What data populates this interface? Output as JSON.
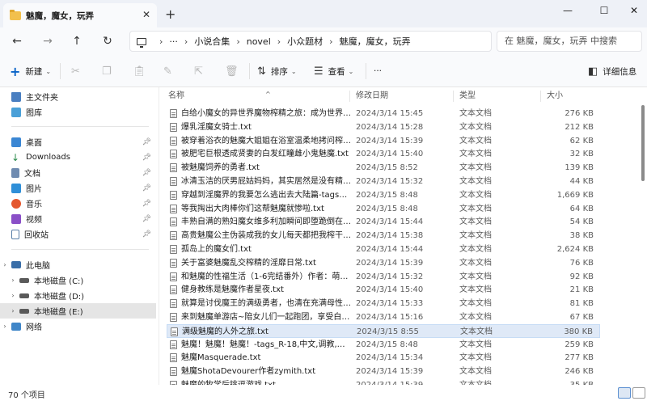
{
  "window": {
    "tab_title": "魅魔，魔女，玩弄",
    "tab_close": "✕",
    "new_tab": "+",
    "minimize": "—",
    "maximize": "☐",
    "close": "✕"
  },
  "nav": {
    "back": "←",
    "forward": "→",
    "up": "↑",
    "refresh": "↻",
    "expand": "›",
    "more": "···",
    "breadcrumb": [
      "小说合集",
      "novel",
      "小众题材",
      "魅魔，魔女，玩弄"
    ],
    "search_placeholder": "在 魅魔，魔女，玩弄 中搜索"
  },
  "toolbar": {
    "new_label": "新建",
    "sort_label": "排序",
    "view_label": "查看",
    "more": "···",
    "details_label": "详细信息",
    "caret": "⌄"
  },
  "sidebar": {
    "home": "主文件夹",
    "gallery": "图库",
    "desktop": "桌面",
    "downloads": "Downloads",
    "documents": "文档",
    "pictures": "图片",
    "music": "音乐",
    "videos": "视频",
    "recycle": "回收站",
    "this_pc": "此电脑",
    "drive_c": "本地磁盘 (C:)",
    "drive_d": "本地磁盘 (D:)",
    "drive_e": "本地磁盘 (E:)",
    "network": "网络",
    "expand_arrow": "›"
  },
  "columns": {
    "name": "名称",
    "date": "修改日期",
    "type": "类型",
    "size": "大小"
  },
  "files": [
    {
      "name": "白给小魔女的异世界魔物榨精之旅：成为世界最...",
      "date": "2024/3/14 15:45",
      "type": "文本文档",
      "size": "276 KB"
    },
    {
      "name": "爆乳淫魔女骑士.txt",
      "date": "2024/3/14 15:28",
      "type": "文本文档",
      "size": "212 KB"
    },
    {
      "name": "被穿着浴衣的魅魔大姐姐在浴室温柔地拷问榨干...",
      "date": "2024/3/14 15:39",
      "type": "文本文档",
      "size": "62 KB"
    },
    {
      "name": "被肥宅巨根透成贤妻的白发红瞳雌小鬼魅魔.txt",
      "date": "2024/3/14 15:40",
      "type": "文本文档",
      "size": "32 KB"
    },
    {
      "name": "被魅魔饲养的勇者.txt",
      "date": "2024/3/15 8:52",
      "type": "文本文档",
      "size": "139 KB"
    },
    {
      "name": "冰清玉洁的厌男屁姑妈妈，其实居然是没有精液...",
      "date": "2024/3/14 15:32",
      "type": "文本文档",
      "size": "44 KB"
    },
    {
      "name": "穿越到淫魔界的我要怎么逃出去大陆篇-tags_R...",
      "date": "2024/3/15 8:48",
      "type": "文本文档",
      "size": "1,669 KB"
    },
    {
      "name": "等我掏出大肉棒你们这帮魅魔就惨啦.txt",
      "date": "2024/3/15 8:48",
      "type": "文本文档",
      "size": "64 KB"
    },
    {
      "name": "丰熟自满的熟妇魔女维多利加瞬间即堕跪倒在雄...",
      "date": "2024/3/14 15:44",
      "type": "文本文档",
      "size": "54 KB"
    },
    {
      "name": "高贵魅魔公主伪装成我的女儿每天都把我榨干这...",
      "date": "2024/3/14 15:38",
      "type": "文本文档",
      "size": "38 KB"
    },
    {
      "name": "孤岛上的魔女们.txt",
      "date": "2024/3/14 15:44",
      "type": "文本文档",
      "size": "2,624 KB"
    },
    {
      "name": "关于富婆魅魔乱交榨精的淫靡日常.txt",
      "date": "2024/3/14 15:39",
      "type": "文本文档",
      "size": "76 KB"
    },
    {
      "name": "和魅魔的性福生活（1-6完结番外）作者：萌猫...",
      "date": "2024/3/14 15:32",
      "type": "文本文档",
      "size": "92 KB"
    },
    {
      "name": "健身教练是魅魔作者星夜.txt",
      "date": "2024/3/14 15:40",
      "type": "文本文档",
      "size": "21 KB"
    },
    {
      "name": "就算是讨伐魔王的满级勇者，也清在充满母性的...",
      "date": "2024/3/14 15:33",
      "type": "文本文档",
      "size": "81 KB"
    },
    {
      "name": "来到魅魔单游店~陪女儿们一起跑团，享受白丝...",
      "date": "2024/3/14 15:16",
      "type": "文本文档",
      "size": "67 KB"
    },
    {
      "name": "满级魅魔的人外之旅.txt",
      "date": "2024/3/15 8:55",
      "type": "文本文档",
      "size": "380 KB"
    },
    {
      "name": "魅魔！魅魔！魅魔！-tags_R-18,中文,调教,ドM...",
      "date": "2024/3/15 8:48",
      "type": "文本文档",
      "size": "259 KB"
    },
    {
      "name": "魅魔Masquerade.txt",
      "date": "2024/3/14 15:34",
      "type": "文本文档",
      "size": "277 KB"
    },
    {
      "name": "魅魔ShotaDevourer作者zymith.txt",
      "date": "2024/3/14 15:39",
      "type": "文本文档",
      "size": "246 KB"
    },
    {
      "name": "魅魔的牧学后挑逗游戏.txt",
      "date": "2024/3/14 15:39",
      "type": "文本文档",
      "size": "35 KB"
    }
  ],
  "status": {
    "item_count": "70 个项目"
  },
  "colors": {
    "selected_row": "#dfe9f7",
    "folder": "#f2c04d",
    "accent": "#0a64c8"
  }
}
